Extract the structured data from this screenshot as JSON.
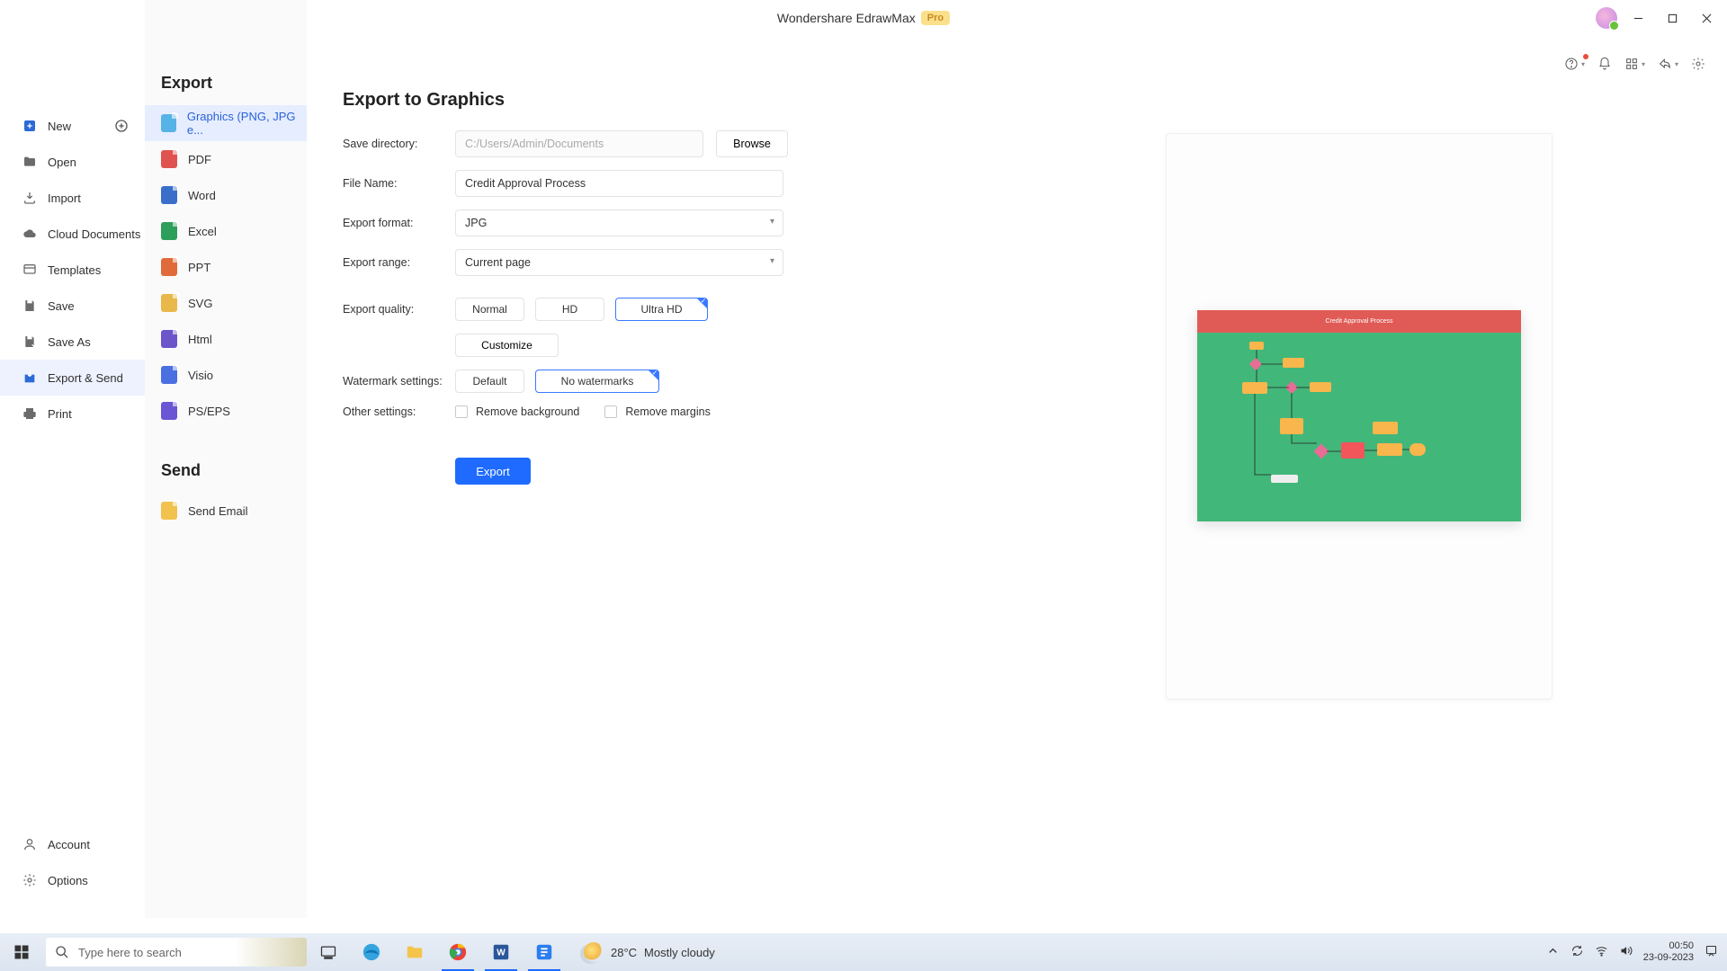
{
  "app": {
    "title": "Wondershare EdrawMax",
    "badge": "Pro"
  },
  "window_controls": {
    "minimize": "minimize",
    "maximize": "restore",
    "close": "close"
  },
  "nav": {
    "items": [
      {
        "id": "new",
        "label": "New",
        "has_plus": true
      },
      {
        "id": "open",
        "label": "Open"
      },
      {
        "id": "import",
        "label": "Import"
      },
      {
        "id": "cloud",
        "label": "Cloud Documents"
      },
      {
        "id": "templates",
        "label": "Templates"
      },
      {
        "id": "save",
        "label": "Save"
      },
      {
        "id": "saveas",
        "label": "Save As"
      },
      {
        "id": "export",
        "label": "Export & Send",
        "active": true
      },
      {
        "id": "print",
        "label": "Print"
      }
    ],
    "bottom": [
      {
        "id": "account",
        "label": "Account"
      },
      {
        "id": "options",
        "label": "Options"
      }
    ]
  },
  "panel": {
    "section_export": "Export",
    "section_send": "Send",
    "formats": [
      {
        "id": "graphics",
        "label": "Graphics (PNG, JPG e...",
        "color": "#55b3e6",
        "active": true
      },
      {
        "id": "pdf",
        "label": "PDF",
        "color": "#e0524f"
      },
      {
        "id": "word",
        "label": "Word",
        "color": "#3a6fc9"
      },
      {
        "id": "excel",
        "label": "Excel",
        "color": "#2e9e5b"
      },
      {
        "id": "ppt",
        "label": "PPT",
        "color": "#e06a3a"
      },
      {
        "id": "svg",
        "label": "SVG",
        "color": "#e9b84a"
      },
      {
        "id": "html",
        "label": "Html",
        "color": "#6b55c9"
      },
      {
        "id": "visio",
        "label": "Visio",
        "color": "#4a6fe0"
      },
      {
        "id": "pseps",
        "label": "PS/EPS",
        "color": "#6a55d4"
      }
    ],
    "send_items": [
      {
        "id": "email",
        "label": "Send Email",
        "color": "#f1c24d"
      }
    ]
  },
  "main": {
    "heading": "Export to Graphics",
    "labels": {
      "save_dir": "Save directory:",
      "file_name": "File Name:",
      "export_format": "Export format:",
      "export_range": "Export range:",
      "export_quality": "Export quality:",
      "watermark": "Watermark settings:",
      "other": "Other settings:"
    },
    "values": {
      "save_dir": "C:/Users/Admin/Documents",
      "file_name": "Credit Approval Process",
      "export_format": "JPG",
      "export_range": "Current page"
    },
    "browse_label": "Browse",
    "quality": {
      "normal": "Normal",
      "hd": "HD",
      "ultra": "Ultra HD",
      "selected": "ultra",
      "customize": "Customize"
    },
    "watermark_options": {
      "default": "Default",
      "none": "No watermarks",
      "selected": "none"
    },
    "other_checks": {
      "remove_bg": "Remove background",
      "remove_margins": "Remove margins"
    },
    "export_btn": "Export",
    "preview_title": "Credit Approval Process"
  },
  "taskbar": {
    "search_placeholder": "Type here to search",
    "weather_temp": "28°C",
    "weather_desc": "Mostly cloudy",
    "time": "00:50",
    "date": "23-09-2023"
  },
  "colors": {
    "accent": "#1f6bff",
    "select_border": "#3a79ff"
  }
}
